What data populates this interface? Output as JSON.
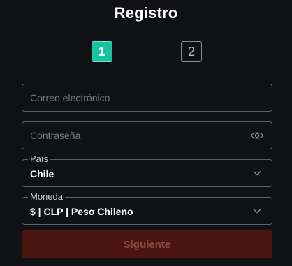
{
  "form": {
    "title": "Registro",
    "steps": [
      "1",
      "2"
    ],
    "current_step": 1,
    "email": {
      "value": "",
      "placeholder": "Correo electrónico"
    },
    "password": {
      "value": "",
      "placeholder": "Contraseña",
      "icon": "eye-icon"
    },
    "country": {
      "label": "País",
      "value": "Chile",
      "icon": "chevron-down-icon"
    },
    "currency": {
      "label": "Moneda",
      "value": "$ | CLP | Peso Chileno",
      "icon": "chevron-down-icon"
    },
    "submit_label": "Siguiente"
  },
  "colors": {
    "background": "#0f1115",
    "step_active": "#17c3a0",
    "button_bg": "#4a1510",
    "button_text": "#8b4a44"
  }
}
